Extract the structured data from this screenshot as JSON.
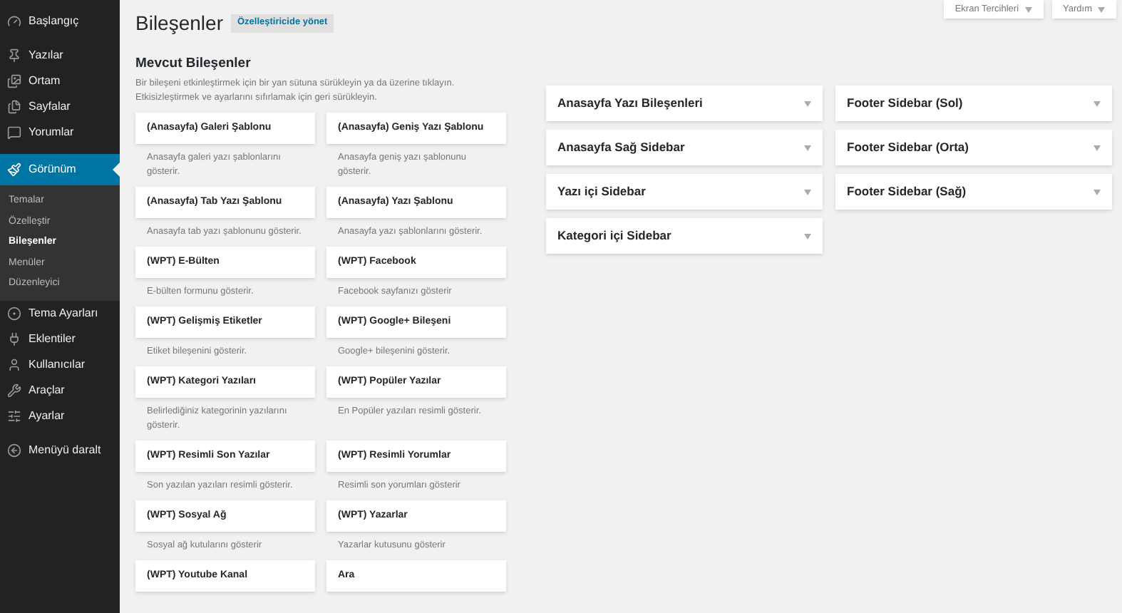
{
  "sidebar": {
    "groups": [
      [
        {
          "label": "Başlangıç",
          "selected": false
        }
      ],
      [
        {
          "label": "Yazılar",
          "selected": false
        },
        {
          "label": "Ortam",
          "selected": false
        },
        {
          "label": "Sayfalar",
          "selected": false
        },
        {
          "label": "Yorumlar",
          "selected": false
        }
      ],
      [
        {
          "label": "Görünüm",
          "selected": true,
          "children": [
            {
              "label": "Temalar",
              "selected": false
            },
            {
              "label": "Özelleştir",
              "selected": false
            },
            {
              "label": "Bileşenler",
              "selected": true
            },
            {
              "label": "Menüler",
              "selected": false
            },
            {
              "label": "Düzenleyici",
              "selected": false
            }
          ]
        },
        {
          "label": "Tema Ayarları",
          "selected": false
        },
        {
          "label": "Eklentiler",
          "selected": false
        },
        {
          "label": "Kullanıcılar",
          "selected": false
        },
        {
          "label": "Araçlar",
          "selected": false
        },
        {
          "label": "Ayarlar",
          "selected": false
        }
      ],
      [
        {
          "label": "Menüyü daralt",
          "selected": false
        }
      ]
    ]
  },
  "screen_options": [
    "Ekran Tercihleri",
    "Yardım"
  ],
  "page": {
    "title": "Bileşenler",
    "action": "Özelleştiricide yönet"
  },
  "available": {
    "title": "Mevcut Bileşenler",
    "description": "Bir bileşeni etkinleştirmek için bir yan sütuna sürükleyin ya da üzerine tıklayın. Etkisizleştirmek ve ayarlarını sıfırlamak için geri sürükleyin.",
    "widgets": [
      {
        "name": "(Anasayfa) Galeri Şablonu",
        "description": "Anasayfa galeri yazı şablonlarını gösterir."
      },
      {
        "name": "(Anasayfa) Geniş Yazı Şablonu",
        "description": "Anasayfa geniş yazı şablonunu gösterir."
      },
      {
        "name": "(Anasayfa) Tab Yazı Şablonu",
        "description": "Anasayfa tab yazı şablonunu gösterir."
      },
      {
        "name": "(Anasayfa) Yazı Şablonu",
        "description": "Anasayfa yazı şablonlarını gösterir."
      },
      {
        "name": "(WPT) E-Bülten",
        "description": "E-bülten formunu gösterir."
      },
      {
        "name": "(WPT) Facebook",
        "description": "Facebook sayfanızı gösterir"
      },
      {
        "name": "(WPT) Gelişmiş Etiketler",
        "description": "Etiket bileşenini gösterir."
      },
      {
        "name": "(WPT) Google+ Bileşeni",
        "description": "Google+ bileşenini gösterir."
      },
      {
        "name": "(WPT) Kategori Yazıları",
        "description": "Belirlediğiniz kategorinin yazılarını gösterir."
      },
      {
        "name": "(WPT) Popüler Yazılar",
        "description": "En Popüler yazıları resimli gösterir."
      },
      {
        "name": "(WPT) Resimli Son Yazılar",
        "description": "Son yazılan yazıları resimli gösterir."
      },
      {
        "name": "(WPT) Resimli Yorumlar",
        "description": "Resimli son yorumları gösterir"
      },
      {
        "name": "(WPT) Sosyal Ağ",
        "description": "Sosyal ağ kutularını gösterir"
      },
      {
        "name": "(WPT) Yazarlar",
        "description": "Yazarlar kutusunu gösterir"
      },
      {
        "name": "(WPT) Youtube Kanal"
      },
      {
        "name": "Ara"
      }
    ]
  },
  "sidebar_areas": [
    [
      "Anasayfa Yazı Bileşenleri",
      "Anasayfa Sağ Sidebar",
      "Yazı içi Sidebar",
      "Kategori içi Sidebar"
    ],
    [
      "Footer Sidebar (Sol)",
      "Footer Sidebar (Orta)",
      "Footer Sidebar (Sağ)"
    ]
  ]
}
